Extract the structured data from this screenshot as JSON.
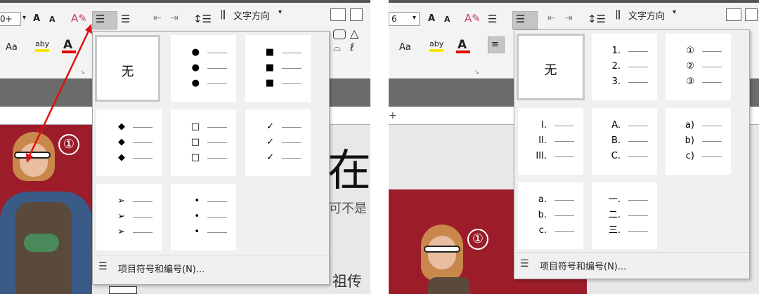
{
  "left_panel": {
    "ribbon": {
      "font_size_value": "0+",
      "grow_font": "A",
      "shrink_font": "A",
      "change_case": "Aa",
      "highlight": "aby",
      "font_color": "A",
      "text_direction": "文字方向",
      "bullets_icon": "☰",
      "numbering_icon": "☰"
    },
    "slide_text": {
      "big": "在",
      "line1": "可不是",
      "line2": "祖传"
    },
    "badge": "①",
    "dropdown": {
      "none_label": "无",
      "bullet_styles": [
        "●",
        "■",
        "◆",
        "□",
        "✓",
        "➢",
        "•"
      ],
      "footer_label": "项目符号和编号(N)..."
    }
  },
  "right_panel": {
    "ribbon": {
      "font_size_value": "6",
      "grow_font": "A",
      "shrink_font": "A",
      "change_case": "Aa",
      "highlight": "aby",
      "font_color": "A",
      "text_direction": "文字方向"
    },
    "badge": "①",
    "dropdown": {
      "none_label": "无",
      "numbering_styles": [
        [
          "1.",
          "2.",
          "3."
        ],
        [
          "①",
          "②",
          "③"
        ],
        [
          "I.",
          "II.",
          "III."
        ],
        [
          "A.",
          "B.",
          "C."
        ],
        [
          "a)",
          "b)",
          "c)"
        ],
        [
          "a.",
          "b.",
          "c."
        ],
        [
          "一.",
          "二.",
          "三."
        ]
      ],
      "footer_label": "项目符号和编号(N)..."
    }
  },
  "colors": {
    "highlight_bar": "#f5e600",
    "font_color_bar": "#e00000",
    "arrow": "#e01010",
    "photo_bg": "#9c1c2a"
  }
}
